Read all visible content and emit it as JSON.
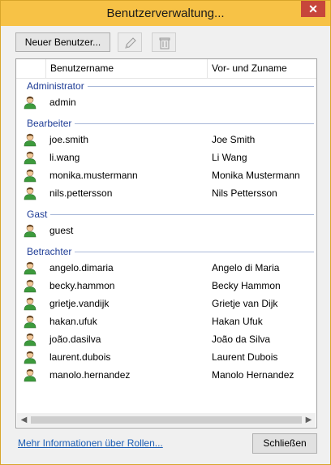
{
  "window": {
    "title": "Benutzerverwaltung...",
    "close_glyph": "✕"
  },
  "toolbar": {
    "new_user_label": "Neuer Benutzer...",
    "edit_icon": "pencil-icon",
    "delete_icon": "trash-icon"
  },
  "table": {
    "columns": [
      "",
      "Benutzername",
      "Vor- und Zuname"
    ],
    "groups": [
      {
        "label": "Administrator",
        "users": [
          {
            "username": "admin",
            "fullname": ""
          }
        ]
      },
      {
        "label": "Bearbeiter",
        "users": [
          {
            "username": "joe.smith",
            "fullname": "Joe Smith"
          },
          {
            "username": "li.wang",
            "fullname": "Li Wang"
          },
          {
            "username": "monika.mustermann",
            "fullname": "Monika Mustermann"
          },
          {
            "username": "nils.pettersson",
            "fullname": "Nils Pettersson"
          }
        ]
      },
      {
        "label": "Gast",
        "users": [
          {
            "username": "guest",
            "fullname": ""
          }
        ]
      },
      {
        "label": "Betrachter",
        "users": [
          {
            "username": "angelo.dimaria",
            "fullname": "Angelo di Maria"
          },
          {
            "username": "becky.hammon",
            "fullname": "Becky Hammon"
          },
          {
            "username": "grietje.vandijk",
            "fullname": "Grietje van Dijk"
          },
          {
            "username": "hakan.ufuk",
            "fullname": "Hakan Ufuk"
          },
          {
            "username": "joão.dasilva",
            "fullname": "João da Silva"
          },
          {
            "username": "laurent.dubois",
            "fullname": "Laurent Dubois"
          },
          {
            "username": "manolo.hernandez",
            "fullname": "Manolo Hernandez"
          }
        ]
      }
    ]
  },
  "scrollbar": {
    "left_arrow": "◀",
    "right_arrow": "▶"
  },
  "footer": {
    "more_info_link": "Mehr Informationen über Rollen...",
    "close_label": "Schließen"
  },
  "colors": {
    "titlebar": "#f7c246",
    "group_label": "#1e3c96",
    "link": "#1e5fb4",
    "avatar_body": "#3c9a3c"
  }
}
